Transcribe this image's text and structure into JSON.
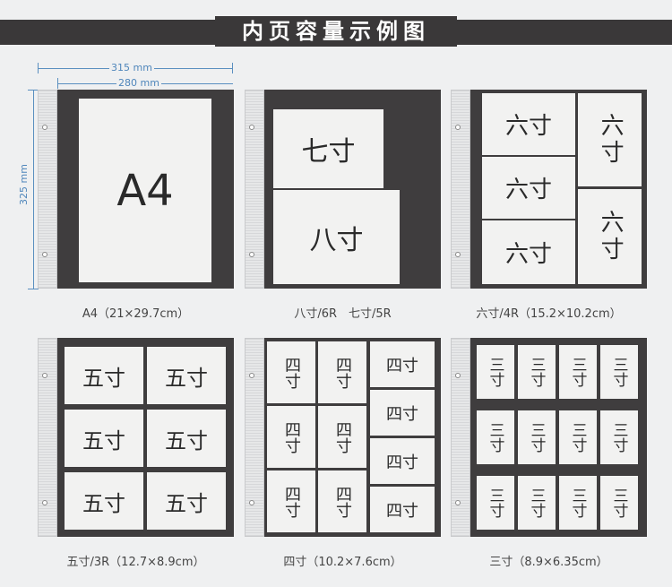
{
  "title": "内页容量示例图",
  "dims": {
    "outer_width": "315 mm",
    "inner_width": "280 mm",
    "height": "325 mm"
  },
  "panels": [
    {
      "caption": "A4（21×29.7cm）",
      "labels": [
        "A4"
      ]
    },
    {
      "caption": "八寸/6R　七寸/5R",
      "labels": [
        "七寸",
        "八寸"
      ]
    },
    {
      "caption": "六寸/4R（15.2×10.2cm）",
      "labels": [
        "六寸"
      ]
    },
    {
      "caption": "五寸/3R（12.7×8.9cm）",
      "labels": [
        "五寸"
      ]
    },
    {
      "caption": "四寸（10.2×7.6cm）",
      "labels": [
        "四寸"
      ]
    },
    {
      "caption": "三寸（8.9×6.35cm）",
      "labels": [
        "三寸"
      ]
    }
  ]
}
